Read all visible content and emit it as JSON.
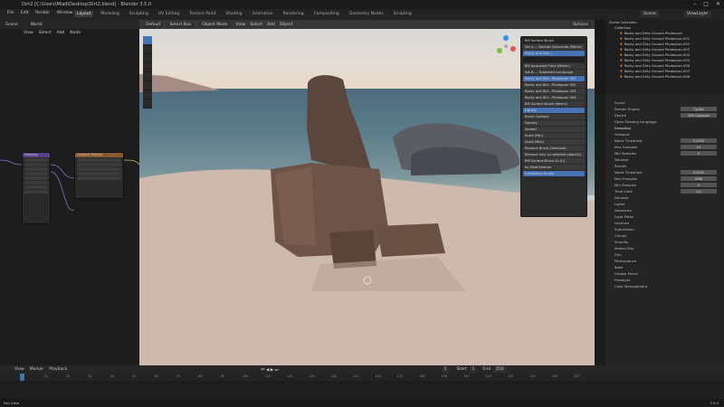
{
  "titlebar": {
    "title": "Dirt2 [C:\\Users\\Miad\\Desktop\\Dirt2.blend] - Blender 3.5.0",
    "controls": [
      "–",
      "□",
      "✕"
    ]
  },
  "topbar": {
    "menus": [
      "File",
      "Edit",
      "Render",
      "Window",
      "Help"
    ],
    "workspaces": [
      "Layout",
      "Modeling",
      "Sculpting",
      "UV Editing",
      "Texture Paint",
      "Shading",
      "Animation",
      "Rendering",
      "Compositing",
      "Geometry Nodes",
      "Scripting"
    ],
    "active_workspace": "Layout",
    "scene": "Scene",
    "view_layer": "ViewLayer"
  },
  "left_editor": {
    "header": [
      "Scene",
      "World"
    ],
    "menu": [
      "View",
      "Select",
      "Add",
      "Node"
    ],
    "node_titles": [
      "Mapping",
      "Gradient Texture"
    ]
  },
  "viewport": {
    "header": {
      "mode": "Object Mode",
      "menus": [
        "View",
        "Select",
        "Add",
        "Object"
      ],
      "orientation": "Default",
      "drag": "Select Box",
      "options": "Options"
    }
  },
  "bagapie_panel": {
    "title": "BM Surface Brush",
    "items": [
      "Set A — Boulder Jacaranda (Metric)",
      "Rocky Arid Dirt…",
      "BM Jacaranda Flora (Metric)",
      "Set B — Scattered Landscape",
      "Rocky and Dirt…Photoscan 001",
      "Rocky and Dirt…Photoscan 002",
      "Rocky and Dirt…Photoscan 003",
      "Rocky and Dirt…Photoscan 004",
      "BM Surface Brush (Metric)",
      "Library",
      "Brush Controls",
      "Density",
      "Spread",
      "Scale (Min)",
      "Scale (Max)",
      "Remove Brush (Selected)",
      "Remove only on selected object(s)",
      "BM Surface Brush v1.0.4",
      "by Miad Kamran",
      "Extensions Studio"
    ],
    "selected_indices": [
      1,
      4,
      9
    ]
  },
  "outliner": {
    "root": "Scene Collection",
    "collection": "Collection",
    "objects": [
      "Rocky and Dirty Ground Photoscan",
      "Rocky and Dirty Ground Photoscan.001",
      "Rocky and Dirty Ground Photoscan.002",
      "Rocky and Dirty Ground Photoscan.003",
      "Rocky and Dirty Ground Photoscan.004",
      "Rocky and Dirty Ground Photoscan.005",
      "Rocky and Dirty Ground Photoscan.006",
      "Rocky and Dirty Ground Photoscan.007",
      "Rocky and Dirty Ground Photoscan.008"
    ]
  },
  "properties": {
    "scene_label": "Scene",
    "render_engine_label": "Render Engine",
    "render_engine": "Cycles",
    "device_label": "Device",
    "device": "GPU Compute",
    "osl_label": "Open Shading Language",
    "sections": [
      "Sampling",
      "Viewport",
      "Noise Threshold",
      "Max Samples",
      "Min Samples",
      "Denoise",
      "Render",
      "Noise Threshold",
      "Max Samples",
      "Min Samples",
      "Time Limit",
      "Denoise",
      "Lights",
      "Advanced",
      "Light Paths",
      "Volumes",
      "Subdivision",
      "Curves",
      "Simplify",
      "Motion Blur",
      "Film",
      "Performance",
      "Bake",
      "Grease Pencil",
      "Freestyle",
      "Color Management"
    ],
    "values": [
      "0.1000",
      "24",
      "0",
      "0.0100",
      "4096",
      "0",
      "0 s"
    ]
  },
  "timeline": {
    "menus": [
      "View",
      "Marker",
      "Playback"
    ],
    "current_frame": "1",
    "start_label": "Start",
    "start": "1",
    "end_label": "End",
    "end": "250",
    "ticks": [
      "0",
      "10",
      "20",
      "30",
      "40",
      "50",
      "60",
      "70",
      "80",
      "90",
      "100",
      "110",
      "120",
      "130",
      "140",
      "150",
      "160",
      "170",
      "180",
      "190",
      "200",
      "210",
      "220",
      "230",
      "240",
      "250"
    ]
  },
  "status": {
    "left": "Pan View",
    "version": "3.5.0"
  },
  "colors": {
    "accent": "#4772b3",
    "orange": "#e07a2c",
    "header": "#232323",
    "panel": "#2b2b2b"
  }
}
